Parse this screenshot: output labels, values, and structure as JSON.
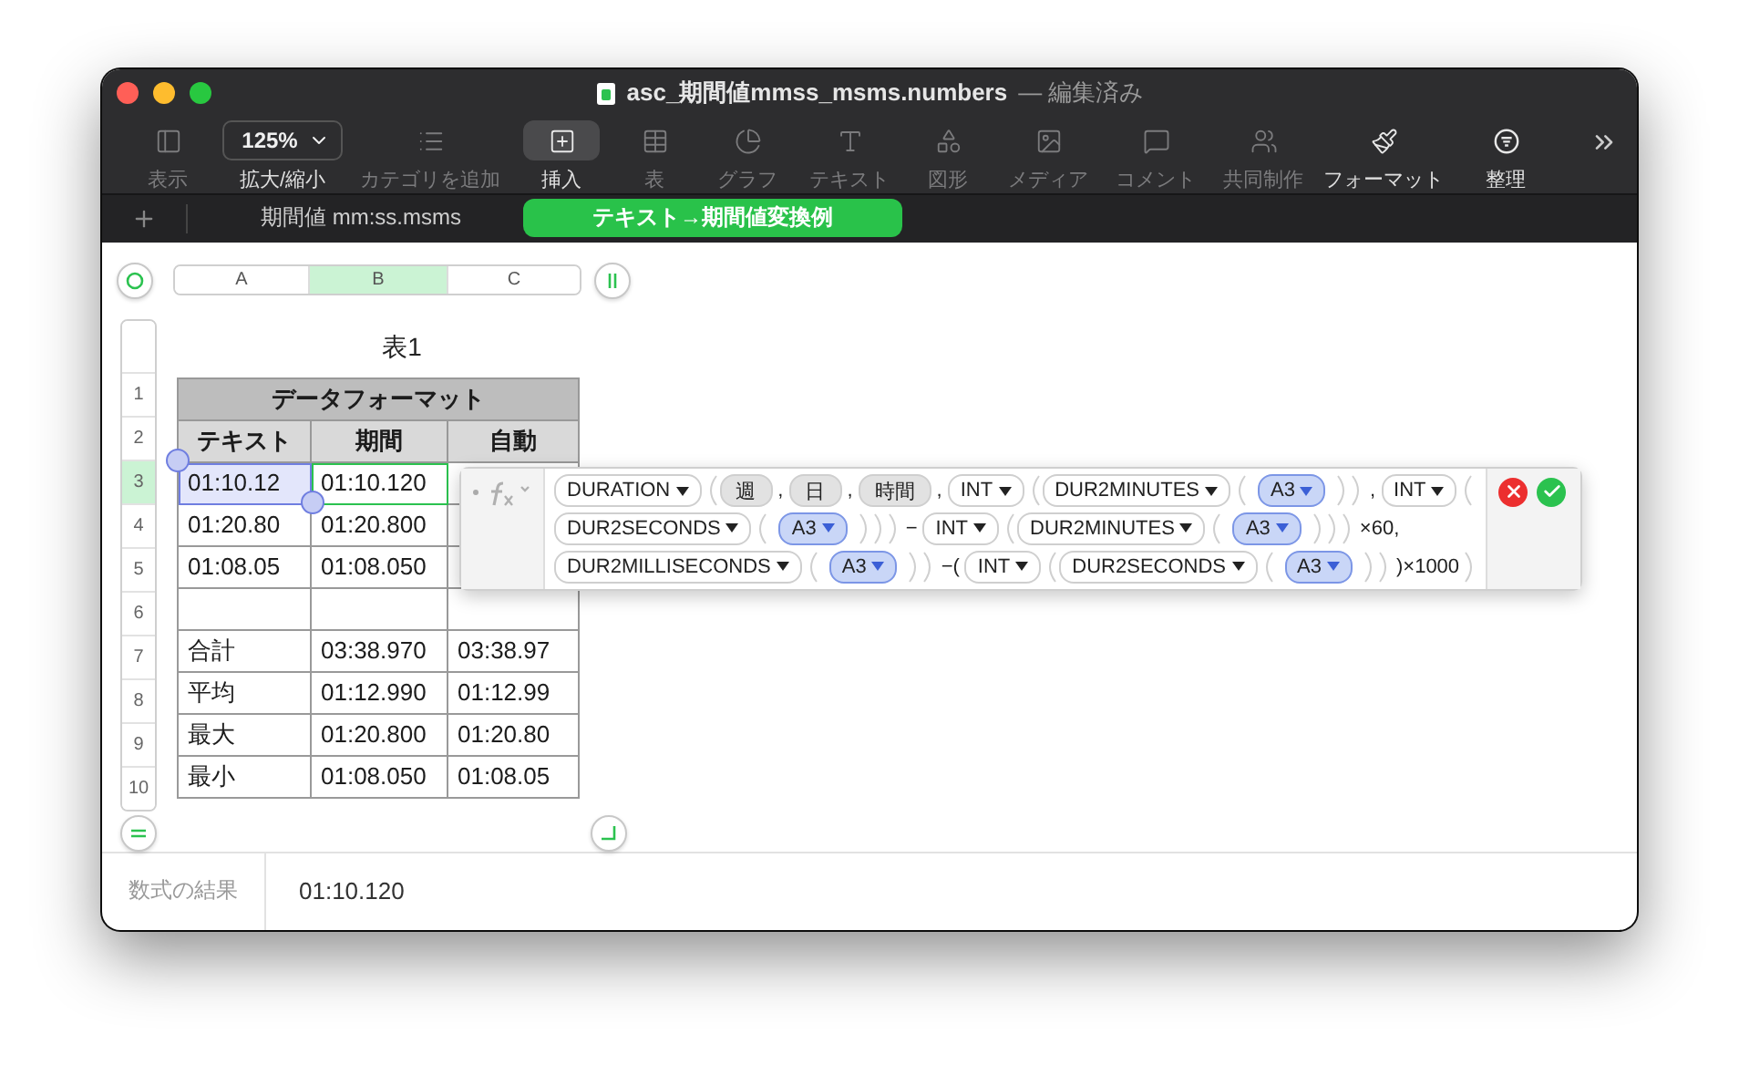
{
  "window": {
    "title": "asc_期間値mmss_msms.numbers",
    "subtitle": "— 編集済み"
  },
  "toolbar": [
    {
      "kind": "button",
      "label": "表示",
      "disabled": true,
      "selected": false
    },
    {
      "kind": "zoom",
      "label": "拡大/縮小",
      "value": "125%",
      "disabled": false,
      "selected": false
    },
    {
      "kind": "button",
      "label": "カテゴリを追加",
      "disabled": true,
      "selected": false
    },
    {
      "kind": "button",
      "label": "挿入",
      "disabled": false,
      "selected": true
    },
    {
      "kind": "button",
      "label": "表",
      "disabled": true,
      "selected": false
    },
    {
      "kind": "button",
      "label": "グラフ",
      "disabled": true,
      "selected": false
    },
    {
      "kind": "button",
      "label": "テキスト",
      "disabled": true,
      "selected": false
    },
    {
      "kind": "button",
      "label": "図形",
      "disabled": true,
      "selected": false
    },
    {
      "kind": "button",
      "label": "メディア",
      "disabled": true,
      "selected": false
    },
    {
      "kind": "button",
      "label": "コメント",
      "disabled": true,
      "selected": false
    },
    {
      "kind": "button",
      "label": "共同制作",
      "disabled": true,
      "selected": false
    },
    {
      "kind": "button",
      "label": "フォーマット",
      "disabled": false,
      "selected": false
    },
    {
      "kind": "button",
      "label": "整理",
      "disabled": false,
      "selected": false
    }
  ],
  "sheet_tabs": [
    {
      "label": "期間値 mm:ss.msms",
      "selected": false
    },
    {
      "label": "テキスト→期間値変換例",
      "selected": true
    }
  ],
  "table": {
    "title": "表1",
    "columns": [
      {
        "label": "A",
        "selected": false
      },
      {
        "label": "B",
        "selected": true
      },
      {
        "label": "C",
        "selected": false
      }
    ],
    "rows": [
      {
        "number": "1",
        "kind": "title",
        "selected": false,
        "cells": [
          {
            "text": "データフォーマット"
          }
        ]
      },
      {
        "number": "2",
        "kind": "header",
        "selected": false,
        "cells": [
          {
            "text": "テキスト"
          },
          {
            "text": "期間"
          },
          {
            "text": "自動"
          }
        ]
      },
      {
        "number": "3",
        "kind": "body",
        "selected": true,
        "cells": [
          {
            "text": "01:10.12",
            "referenced": true,
            "active": false
          },
          {
            "text": "01:10.120",
            "referenced": false,
            "active": true
          },
          {
            "referenced": false,
            "active": false
          }
        ]
      },
      {
        "number": "4",
        "kind": "body",
        "selected": false,
        "cells": [
          {
            "text": "01:20.80",
            "referenced": false,
            "active": false
          },
          {
            "text": "01:20.800",
            "referenced": false,
            "active": false
          },
          {
            "referenced": false,
            "active": false
          }
        ]
      },
      {
        "number": "5",
        "kind": "body",
        "selected": false,
        "cells": [
          {
            "text": "01:08.05",
            "referenced": false,
            "active": false
          },
          {
            "text": "01:08.050",
            "referenced": false,
            "active": false
          },
          {
            "referenced": false,
            "active": false
          }
        ]
      },
      {
        "number": "6",
        "kind": "body",
        "selected": false,
        "cells": [
          {
            "referenced": false,
            "active": false
          },
          {
            "referenced": false,
            "active": false
          },
          {
            "referenced": false,
            "active": false
          }
        ]
      },
      {
        "number": "7",
        "kind": "footer",
        "selected": false,
        "cells": [
          {
            "text": "合計",
            "referenced": false,
            "active": false
          },
          {
            "text": "03:38.970",
            "referenced": false,
            "active": false
          },
          {
            "text": "03:38.97",
            "referenced": false,
            "active": false
          }
        ]
      },
      {
        "number": "8",
        "kind": "footer",
        "selected": false,
        "cells": [
          {
            "text": "平均",
            "referenced": false,
            "active": false
          },
          {
            "text": "01:12.990",
            "referenced": false,
            "active": false
          },
          {
            "text": "01:12.99",
            "referenced": false,
            "active": false
          }
        ]
      },
      {
        "number": "9",
        "kind": "footer",
        "selected": false,
        "cells": [
          {
            "text": "最大",
            "referenced": false,
            "active": false
          },
          {
            "text": "01:20.800",
            "referenced": false,
            "active": false
          },
          {
            "text": "01:20.80",
            "referenced": false,
            "active": false
          }
        ]
      },
      {
        "number": "10",
        "kind": "footer",
        "selected": false,
        "cells": [
          {
            "text": "最小",
            "referenced": false,
            "active": false
          },
          {
            "text": "01:08.050",
            "referenced": false,
            "active": false
          },
          {
            "text": "01:08.05",
            "referenced": false,
            "active": false
          }
        ]
      }
    ]
  },
  "formula_editor": {
    "lines": [
      [
        {
          "kind": "func",
          "text": "DURATION"
        },
        {
          "kind": "open"
        },
        {
          "kind": "arg",
          "text": "週"
        },
        {
          "kind": "sep",
          "text": ","
        },
        {
          "kind": "arg",
          "text": "日"
        },
        {
          "kind": "sep",
          "text": ","
        },
        {
          "kind": "arg",
          "text": "時間"
        },
        {
          "kind": "sep",
          "text": ","
        },
        {
          "kind": "func",
          "text": "INT"
        },
        {
          "kind": "open"
        },
        {
          "kind": "func",
          "text": "DUR2MINUTES"
        },
        {
          "kind": "open"
        },
        {
          "kind": "ref",
          "text": "A3"
        },
        {
          "kind": "close"
        },
        {
          "kind": "close"
        },
        {
          "kind": "sep",
          "text": ","
        },
        {
          "kind": "func",
          "text": "INT"
        },
        {
          "kind": "open"
        }
      ],
      [
        {
          "kind": "func",
          "text": "DUR2SECONDS"
        },
        {
          "kind": "open"
        },
        {
          "kind": "ref",
          "text": "A3"
        },
        {
          "kind": "close"
        },
        {
          "kind": "close"
        },
        {
          "kind": "close"
        },
        {
          "kind": "sep",
          "text": "−"
        },
        {
          "kind": "func",
          "text": "INT"
        },
        {
          "kind": "open"
        },
        {
          "kind": "func",
          "text": "DUR2MINUTES"
        },
        {
          "kind": "open"
        },
        {
          "kind": "ref",
          "text": "A3"
        },
        {
          "kind": "close"
        },
        {
          "kind": "close"
        },
        {
          "kind": "close"
        },
        {
          "kind": "sep",
          "text": "×60,"
        }
      ],
      [
        {
          "kind": "func",
          "text": "DUR2MILLISECONDS"
        },
        {
          "kind": "open"
        },
        {
          "kind": "ref",
          "text": "A3"
        },
        {
          "kind": "close"
        },
        {
          "kind": "close"
        },
        {
          "kind": "sep",
          "text": "−("
        },
        {
          "kind": "func",
          "text": "INT"
        },
        {
          "kind": "open"
        },
        {
          "kind": "func",
          "text": "DUR2SECONDS"
        },
        {
          "kind": "open"
        },
        {
          "kind": "ref",
          "text": "A3"
        },
        {
          "kind": "close"
        },
        {
          "kind": "close"
        },
        {
          "kind": "sep",
          "text": ")×1000"
        },
        {
          "kind": "close"
        }
      ]
    ]
  },
  "formula_result": {
    "label": "数式の結果",
    "value": "01:10.120"
  }
}
